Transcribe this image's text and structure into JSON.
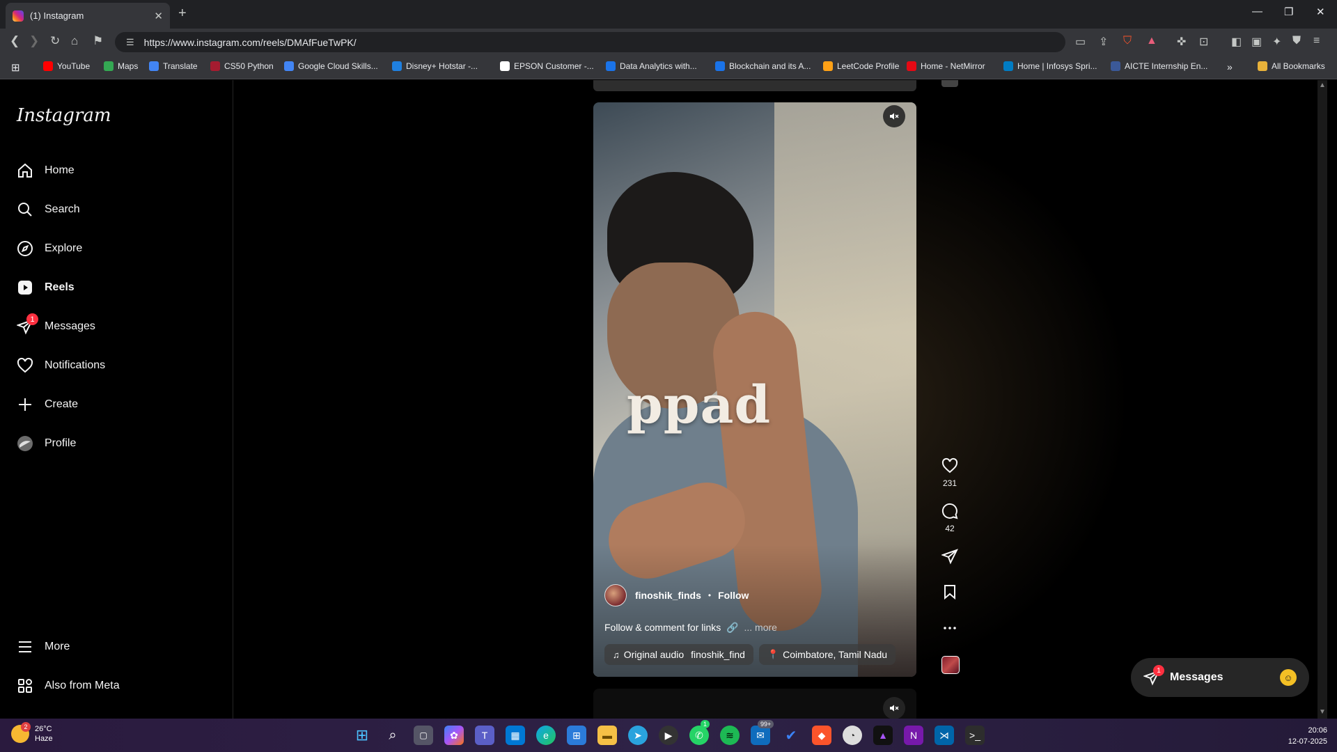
{
  "browser": {
    "tab_title": "(1) Instagram",
    "url": "https://www.instagram.com/reels/DMAfFueTwPK/",
    "bookmarks": [
      {
        "label": "YouTube",
        "color": "#ff0000"
      },
      {
        "label": "Maps",
        "color": "#34a853"
      },
      {
        "label": "Translate",
        "color": "#4285f4"
      },
      {
        "label": "CS50 Python",
        "color": "#a51c30"
      },
      {
        "label": "Google Cloud Skills...",
        "color": "#4285f4"
      },
      {
        "label": "Disney+ Hotstar -...",
        "color": "#1f80e0"
      },
      {
        "label": "EPSON Customer -...",
        "color": "#ffffff"
      },
      {
        "label": "Data Analytics with...",
        "color": "#1a73e8"
      },
      {
        "label": "Blockchain and its A...",
        "color": "#1a73e8"
      },
      {
        "label": "LeetCode Profile",
        "color": "#ffa116"
      },
      {
        "label": "Home - NetMirror",
        "color": "#e50914"
      },
      {
        "label": "Home | Infosys Spri...",
        "color": "#007cc3"
      },
      {
        "label": "AICTE Internship En...",
        "color": "#3b5998"
      }
    ],
    "all_bookmarks": "All Bookmarks"
  },
  "sidebar": {
    "logo": "Instagram",
    "items": [
      {
        "label": "Home",
        "icon": "home-icon"
      },
      {
        "label": "Search",
        "icon": "search-icon"
      },
      {
        "label": "Explore",
        "icon": "compass-icon"
      },
      {
        "label": "Reels",
        "icon": "reels-icon"
      },
      {
        "label": "Messages",
        "icon": "messenger-icon",
        "badge": "1"
      },
      {
        "label": "Notifications",
        "icon": "heart-icon"
      },
      {
        "label": "Create",
        "icon": "plus-icon"
      },
      {
        "label": "Profile",
        "icon": "avatar-icon"
      }
    ],
    "more": "More",
    "meta": "Also from Meta"
  },
  "reel": {
    "overlay_text": "ppad",
    "username": "finoshik_finds",
    "separator": "•",
    "follow": "Follow",
    "caption": "Follow & comment for links",
    "caption_more": "... more",
    "audio": "Original audio",
    "audio_owner": "finoshik_find",
    "location": "Coimbatore, Tamil Nadu"
  },
  "actions": {
    "likes": "231",
    "comments": "42"
  },
  "messages_pill": {
    "label": "Messages",
    "badge": "1"
  },
  "taskbar": {
    "temp": "26°C",
    "weather": "Haze",
    "weather_badge": "2",
    "whatsapp_badge": "1",
    "mail_badge": "99+",
    "time": "20:06",
    "date": "12-07-2025"
  },
  "colors": {
    "accent_badge": "#ff3040",
    "background": "#000000"
  }
}
